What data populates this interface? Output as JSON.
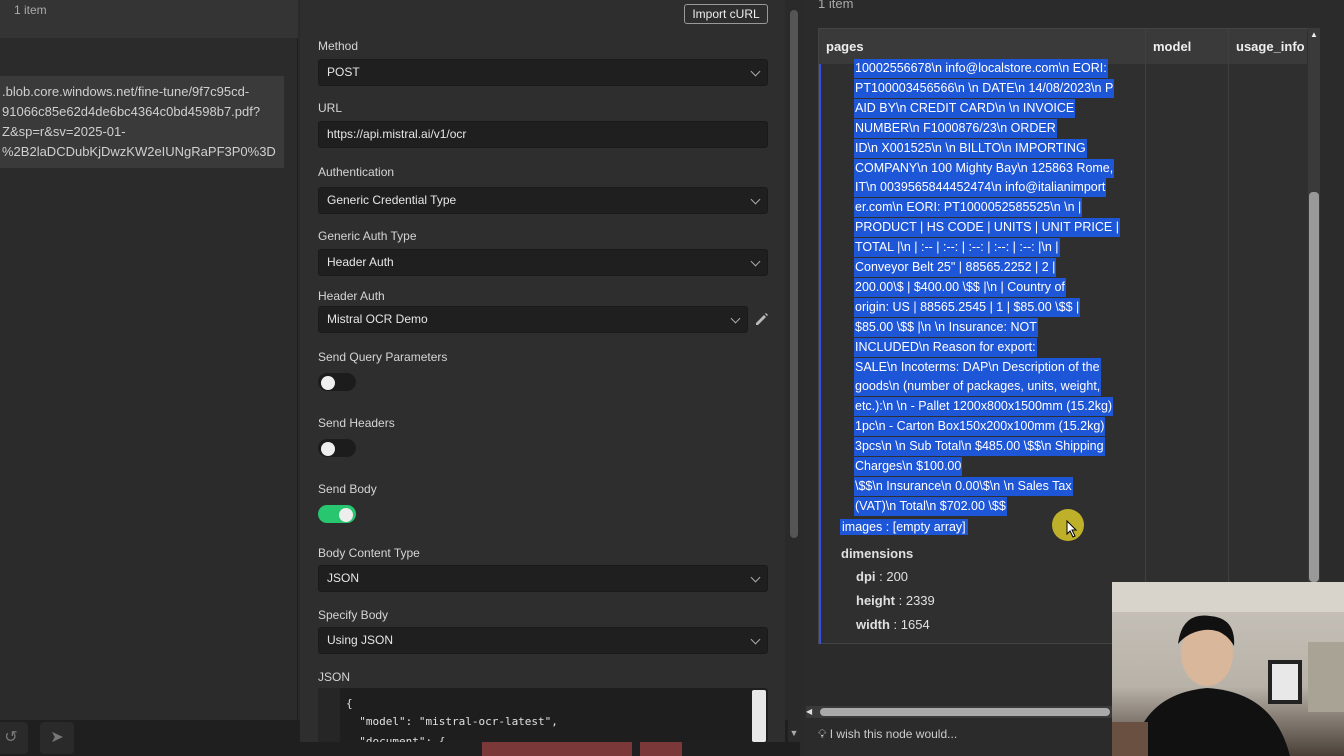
{
  "left": {
    "count": "1 item",
    "url_lines": [
      ".blob.core.windows.net/fine-tune/9f7c95cd-",
      "91066c85e62d4de6bc4364c0bd4598b7.pdf?",
      "Z&sp=r&sv=2025-01-",
      "%2B2laDCDubKjDwzKW2eIUNgRaPF3P0%3D"
    ]
  },
  "params": {
    "import_curl": "Import cURL",
    "method_label": "Method",
    "method_value": "POST",
    "url_label": "URL",
    "url_value": "https://api.mistral.ai/v1/ocr",
    "auth_label": "Authentication",
    "auth_value": "Generic Credential Type",
    "generic_auth_label": "Generic Auth Type",
    "generic_auth_value": "Header Auth",
    "header_auth_label": "Header Auth",
    "header_auth_value": "Mistral OCR Demo",
    "send_query_label": "Send Query Parameters",
    "send_query_on": false,
    "send_headers_label": "Send Headers",
    "send_headers_on": false,
    "send_body_label": "Send Body",
    "send_body_on": true,
    "body_content_label": "Body Content Type",
    "body_content_value": "JSON",
    "specify_body_label": "Specify Body",
    "specify_body_value": "Using JSON",
    "json_label": "JSON",
    "json_lines": [
      "{",
      "  \"model\": \"mistral-ocr-latest\",",
      "  \"document\": {"
    ]
  },
  "output": {
    "count": "1 item",
    "columns": [
      "pages",
      "model",
      "usage_info"
    ],
    "markdown_lines": [
      "10002556678\\n info@localstore.com\\n EORI:",
      "PT100003456566\\n \\n DATE\\n 14/08/2023\\n P",
      "AID BY\\n CREDIT CARD\\n \\n INVOICE",
      "NUMBER\\n F1000876/23\\n ORDER",
      "ID\\n X001525\\n \\n BILLTO\\n IMPORTING",
      "COMPANY\\n 100 Mighty Bay\\n 125863 Rome,",
      "IT\\n 0039565844452474\\n info@italianimport",
      "er.com\\n EORI: PT1000052585525\\n \\n |",
      "PRODUCT | HS CODE | UNITS | UNIT PRICE |",
      "TOTAL |\\n | :-- | :--: | :--: | :--: | :--: |\\n |",
      "Conveyor Belt 25\" | 88565.2252 | 2 |",
      "200.00\\$ | $400.00 \\$$ |\\n | Country of",
      "origin: US | 88565.2545 | 1 | $85.00 \\$$ |",
      "$85.00 \\$$ |\\n \\n Insurance: NOT",
      "INCLUDED\\n Reason for export:",
      "SALE\\n Incoterms: DAP\\n Description of the",
      "goods\\n (number of packages, units, weight,",
      "etc.):\\n \\n - Pallet 1200x800x1500mm (15.2kg)",
      "1pc\\n - Carton Box150x200x100mm (15.2kg)",
      "3pcs\\n \\n Sub Total\\n $485.00 \\$$\\n Shipping",
      "Charges\\n $100.00",
      "\\$$\\n Insurance\\n 0.00\\$\\n \\n Sales Tax",
      "(VAT)\\n Total\\n $702.00 \\$$"
    ],
    "images_key": "images",
    "images_value": "[empty array]",
    "dimensions_key": "dimensions",
    "dpi_key": "dpi",
    "dpi_value": "200",
    "height_key": "height",
    "height_value": "2339",
    "width_key": "width",
    "width_value": "1654",
    "feedback": "I wish this node would..."
  }
}
